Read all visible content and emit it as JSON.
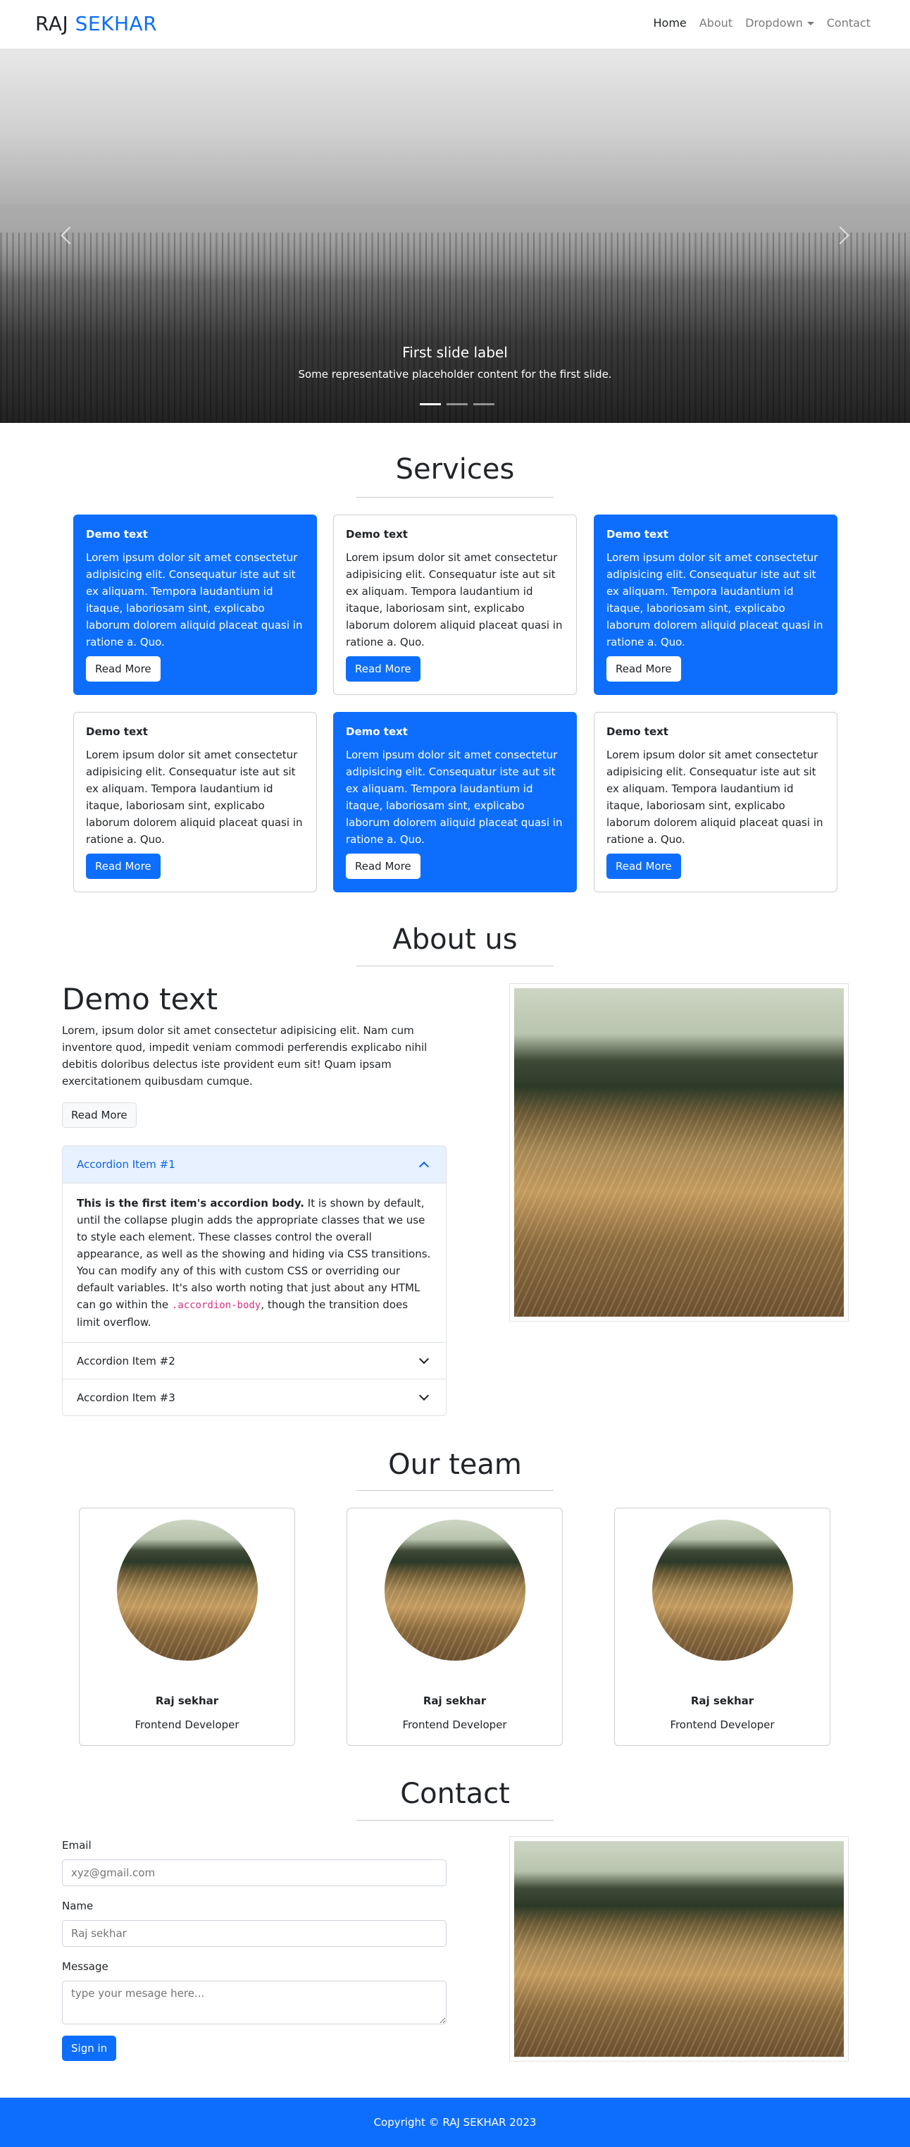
{
  "nav": {
    "brand_first": "RAJ",
    "brand_accent": "SEKHAR",
    "links": {
      "home": "Home",
      "about": "About",
      "dropdown": "Dropdown",
      "contact": "Contact"
    }
  },
  "carousel": {
    "title": "First slide label",
    "text": "Some representative placeholder content for the first slide.",
    "slide_count": 3,
    "active_slide": 1
  },
  "services": {
    "heading": "Services",
    "cards": [
      {
        "title": "Demo text",
        "text": "Lorem ipsum dolor sit amet consectetur adipisicing elit. Consequatur iste aut sit ex aliquam. Tempora laudantium id itaque, laboriosam sint, explicabo laborum dolorem aliquid placeat quasi in ratione a. Quo.",
        "button": "Read More"
      },
      {
        "title": "Demo text",
        "text": "Lorem ipsum dolor sit amet consectetur adipisicing elit. Consequatur iste aut sit ex aliquam. Tempora laudantium id itaque, laboriosam sint, explicabo laborum dolorem aliquid placeat quasi in ratione a. Quo.",
        "button": "Read More"
      },
      {
        "title": "Demo text",
        "text": "Lorem ipsum dolor sit amet consectetur adipisicing elit. Consequatur iste aut sit ex aliquam. Tempora laudantium id itaque, laboriosam sint, explicabo laborum dolorem aliquid placeat quasi in ratione a. Quo.",
        "button": "Read More"
      },
      {
        "title": "Demo text",
        "text": "Lorem ipsum dolor sit amet consectetur adipisicing elit. Consequatur iste aut sit ex aliquam. Tempora laudantium id itaque, laboriosam sint, explicabo laborum dolorem aliquid placeat quasi in ratione a. Quo.",
        "button": "Read More"
      },
      {
        "title": "Demo text",
        "text": "Lorem ipsum dolor sit amet consectetur adipisicing elit. Consequatur iste aut sit ex aliquam. Tempora laudantium id itaque, laboriosam sint, explicabo laborum dolorem aliquid placeat quasi in ratione a. Quo.",
        "button": "Read More"
      },
      {
        "title": "Demo text",
        "text": "Lorem ipsum dolor sit amet consectetur adipisicing elit. Consequatur iste aut sit ex aliquam. Tempora laudantium id itaque, laboriosam sint, explicabo laborum dolorem aliquid placeat quasi in ratione a. Quo.",
        "button": "Read More"
      }
    ]
  },
  "about": {
    "heading": "About us",
    "subheading": "Demo text",
    "text": "Lorem, ipsum dolor sit amet consectetur adipisicing elit. Nam cum inventore quod, impedit veniam commodi perferendis explicabo nihil debitis doloribus delectus iste provident eum sit! Quam ipsam exercitationem quibusdam cumque.",
    "button": "Read More",
    "accordion": {
      "items": [
        {
          "label": "Accordion Item #1"
        },
        {
          "label": "Accordion Item #2"
        },
        {
          "label": "Accordion Item #3"
        }
      ],
      "body_strong": "This is the first item's accordion body.",
      "body_text": " It is shown by default, until the collapse plugin adds the appropriate classes that we use to style each element. These classes control the overall appearance, as well as the showing and hiding via CSS transitions. You can modify any of this with custom CSS or overriding our default variables. It's also worth noting that just about any HTML can go within the ",
      "body_code": ".accordion-body",
      "body_end": ", though the transition does limit overflow."
    }
  },
  "team": {
    "heading": "Our team",
    "members": [
      {
        "name": "Raj sekhar",
        "role": "Frontend Developer"
      },
      {
        "name": "Raj sekhar",
        "role": "Frontend Developer"
      },
      {
        "name": "Raj sekhar",
        "role": "Frontend Developer"
      }
    ]
  },
  "contact": {
    "heading": "Contact",
    "email_label": "Email",
    "email_placeholder": "xyz@gmail.com",
    "name_label": "Name",
    "name_placeholder": "Raj sekhar",
    "message_label": "Message",
    "message_placeholder": "type your mesage here...",
    "submit": "Sign in"
  },
  "footer": {
    "text": "Copyright © RAJ SEKHAR 2023"
  },
  "colors": {
    "primary": "#0d6efd",
    "accordion_active_bg": "#e7f1ff",
    "code": "#d63384"
  }
}
